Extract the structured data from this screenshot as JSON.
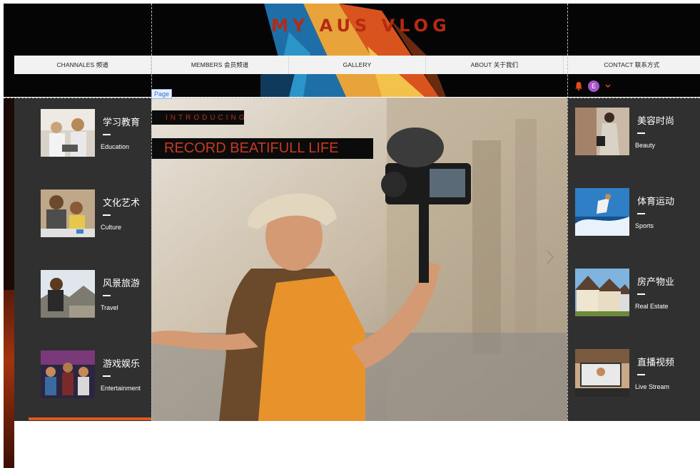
{
  "site": {
    "title": "MY AUS VLOG"
  },
  "nav": {
    "items": [
      {
        "label": "CHANNALES 频道"
      },
      {
        "label": "MEMBERS 会员频道"
      },
      {
        "label": "GALLERY"
      },
      {
        "label": "ABOUT 关于我们"
      },
      {
        "label": "CONTACT 联系方式"
      }
    ]
  },
  "header": {
    "avatar_letter": "E",
    "page_tag": "Page"
  },
  "hero": {
    "intro": "INTRODUCING",
    "headline": "RECORD BEATIFULL LIFE"
  },
  "left_categories": [
    {
      "zh": "学习教育",
      "en": "Education"
    },
    {
      "zh": "文化艺术",
      "en": "Culture"
    },
    {
      "zh": "风景旅游",
      "en": "Travel"
    },
    {
      "zh": "游戏娱乐",
      "en": "Entertainment"
    }
  ],
  "right_categories": [
    {
      "zh": "美容时尚",
      "en": "Beauty"
    },
    {
      "zh": "体育运动",
      "en": "Sports"
    },
    {
      "zh": "房产物业",
      "en": "Real Estate"
    },
    {
      "zh": "直播视频",
      "en": "Live Stream"
    }
  ],
  "colors": {
    "accent": "#b52a13",
    "panel": "#303030",
    "avatar": "#a454c9"
  }
}
